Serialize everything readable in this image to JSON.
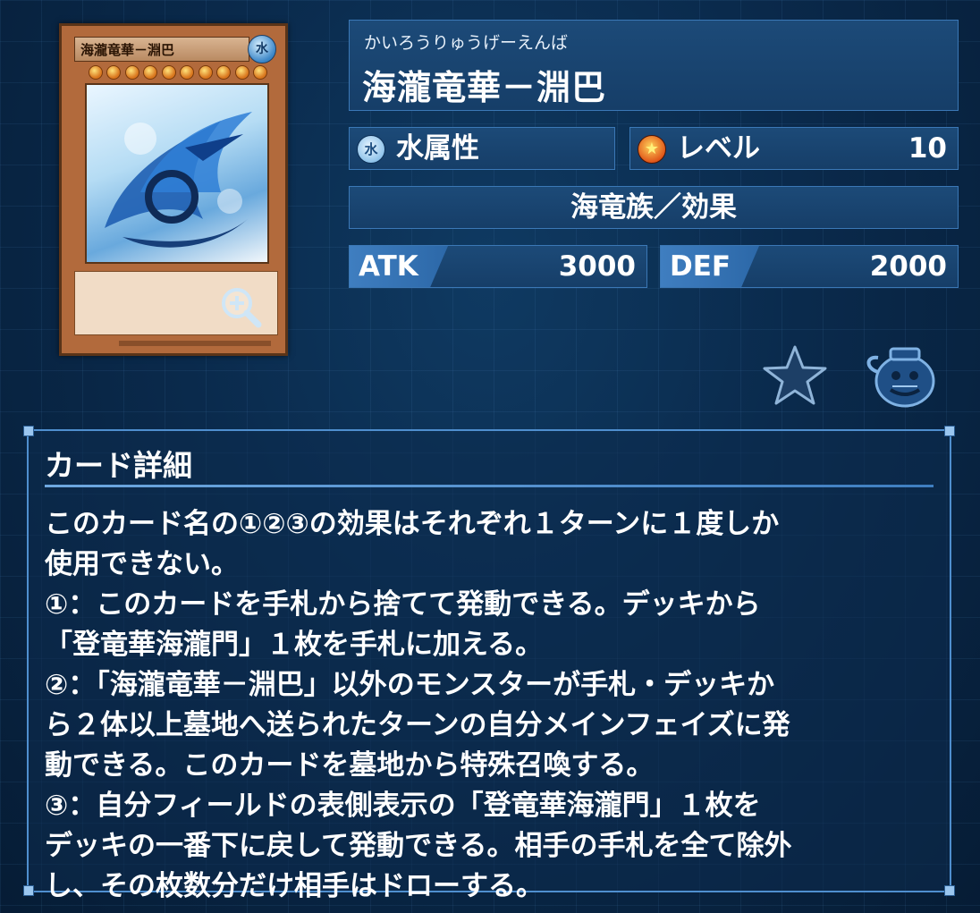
{
  "card": {
    "image_name_text": "海瀧竜華－淵巴",
    "attribute_glyph": "水"
  },
  "name": {
    "reading": "かいろうりゅうげーえんば",
    "title": "海瀧竜華－淵巴"
  },
  "attribute": {
    "icon": "water-attribute-icon",
    "glyph": "水",
    "label": "水属性"
  },
  "level": {
    "icon": "level-star-icon",
    "label": "レベル",
    "value": "10"
  },
  "type_line": "海竜族／効果",
  "stats": {
    "atk_label": "ATK",
    "atk_value": "3000",
    "def_label": "DEF",
    "def_value": "2000"
  },
  "actions": {
    "favorite": "star-icon",
    "pot": "pot-of-greed-icon",
    "zoom": "magnify-icon"
  },
  "details": {
    "title": "カード詳細",
    "lines": [
      "このカード名の①②③の効果はそれぞれ１ターンに１度しか",
      "使用できない。",
      "①：このカードを手札から捨てて発動できる。デッキから",
      "「登竜華海瀧門」１枚を手札に加える。",
      "②：「海瀧竜華－淵巴」以外のモンスターが手札・デッキか",
      "ら２体以上墓地へ送られたターンの自分メインフェイズに発",
      "動できる。このカードを墓地から特殊召喚する。",
      "③：自分フィールドの表側表示の「登竜華海瀧門」１枚を",
      "デッキの一番下に戻して発動できる。相手の手札を全て除外",
      "し、その枚数分だけ相手はドローする。"
    ]
  },
  "colors": {
    "background": "#0a2a4c",
    "panel": "#1c4a78",
    "panel_border": "#3b78b6",
    "card_frame": "#b26a3c"
  }
}
